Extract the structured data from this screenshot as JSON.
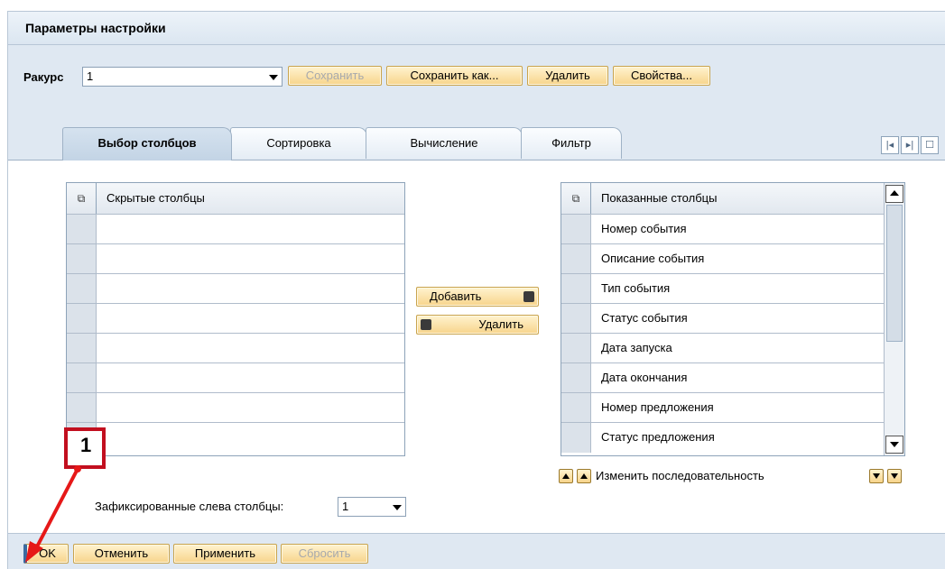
{
  "window": {
    "title": "Параметры настройки"
  },
  "view": {
    "label": "Ракурс",
    "value": "1",
    "buttons": {
      "save": "Сохранить",
      "save_as": "Сохранить как...",
      "delete": "Удалить",
      "properties": "Свойства..."
    }
  },
  "tabs": [
    "Выбор столбцов",
    "Сортировка",
    "Вычисление",
    "Фильтр"
  ],
  "active_tab": "Выбор столбцов",
  "hidden_columns": {
    "header": "Скрытые столбцы",
    "rows": [
      "",
      "",
      "",
      "",
      "",
      "",
      "",
      ""
    ]
  },
  "move_buttons": {
    "add": "Добавить",
    "remove": "Удалить"
  },
  "shown_columns": {
    "header": "Показанные столбцы",
    "rows": [
      "Номер события",
      "Описание события",
      "Тип события",
      "Статус события",
      "Дата запуска",
      "Дата окончания",
      "Номер предложения",
      "Статус предложения"
    ]
  },
  "reorder_label": "Изменить последовательность",
  "fixed_columns": {
    "label": "Зафиксированные слева столбцы:",
    "value": "1"
  },
  "footer": {
    "ok": "OK",
    "cancel": "Отменить",
    "apply": "Применить",
    "reset": "Сбросить"
  },
  "annotation": {
    "number": "1",
    "color": "#c20f1f"
  },
  "icons": [
    "grid-settings-icon",
    "first-page-icon",
    "last-page-icon",
    "list-icon",
    "scroll-up-icon",
    "scroll-down-icon",
    "move-top-icon",
    "move-up-icon",
    "move-down-icon",
    "move-bottom-icon",
    "arrow-right-icon",
    "arrow-left-icon"
  ]
}
